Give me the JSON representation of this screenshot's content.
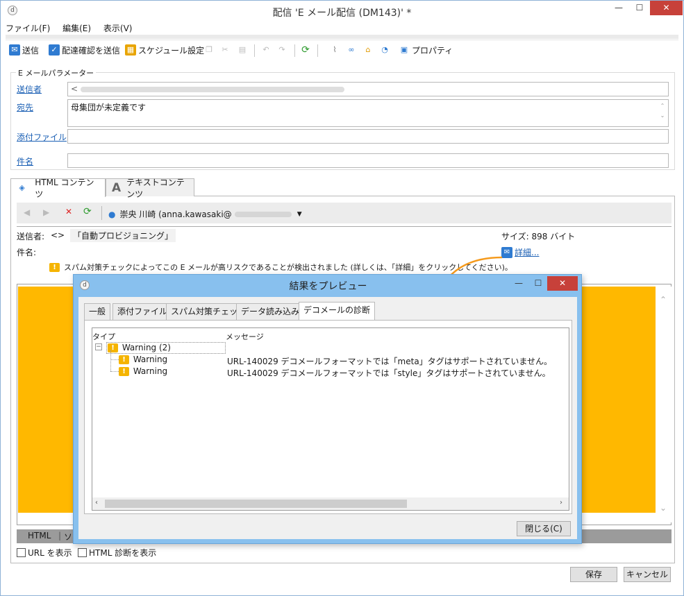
{
  "window": {
    "title": "配信 'E メール配信 (DM143)' *",
    "app_icon": "adobe-campaign-icon"
  },
  "menu": [
    "ファイル(F)",
    "編集(E)",
    "表示(V)"
  ],
  "toolbar": {
    "send": "送信",
    "send_proof": "配達確認を送信",
    "schedule": "スケジュール設定",
    "properties": "プロパティ"
  },
  "params": {
    "group_label": "E メールパラメーター",
    "from_label": "送信者",
    "from_value": "<",
    "to_label": "宛先",
    "to_value": "母集団が未定義です",
    "attach_label": "添付ファイル",
    "subject_label": "件名"
  },
  "tabs": {
    "html": "HTML コンテンツ",
    "text": "テキストコンテンツ"
  },
  "recipient": {
    "name": "崇央 川崎 (anna.kawasaki@"
  },
  "preview_header": {
    "sender_label": "送信者:",
    "sender_value": "<>",
    "sender_name": "「自動プロビジョニング」",
    "size": "サイズ: 898 バイト",
    "subject_label": "件名:",
    "details_link": "詳細...",
    "spam_warning": "スパム対策チェックによってこの E メールが高リスクであることが検出されました (詳しくは、「詳細」をクリックしてください)。"
  },
  "bottom_tabs": [
    "HTML",
    "ソ"
  ],
  "checkboxes": {
    "show_url": "URL を表示",
    "show_html_diag": "HTML 診断を表示"
  },
  "buttons": {
    "save": "保存",
    "cancel": "キャンセル"
  },
  "dialog": {
    "title": "結果をプレビュー",
    "tabs": [
      "一般",
      "添付ファイル",
      "スパム対策チェック",
      "データ読み込み",
      "デコメールの診断"
    ],
    "col_type": "タイプ",
    "col_message": "メッセージ",
    "group": "Warning (2)",
    "rows": [
      {
        "type": "Warning",
        "message": "URL-140029 デコメールフォーマットでは「meta」タグはサポートされていません。"
      },
      {
        "type": "Warning",
        "message": "URL-140029 デコメールフォーマットでは「style」タグはサポートされていません。"
      }
    ],
    "close": "閉じる(C)"
  },
  "colors": {
    "accent_orange": "#ffb800",
    "link": "#1a5fb4",
    "dialog_frame": "#88c0ee",
    "close_red": "#c7413a"
  }
}
